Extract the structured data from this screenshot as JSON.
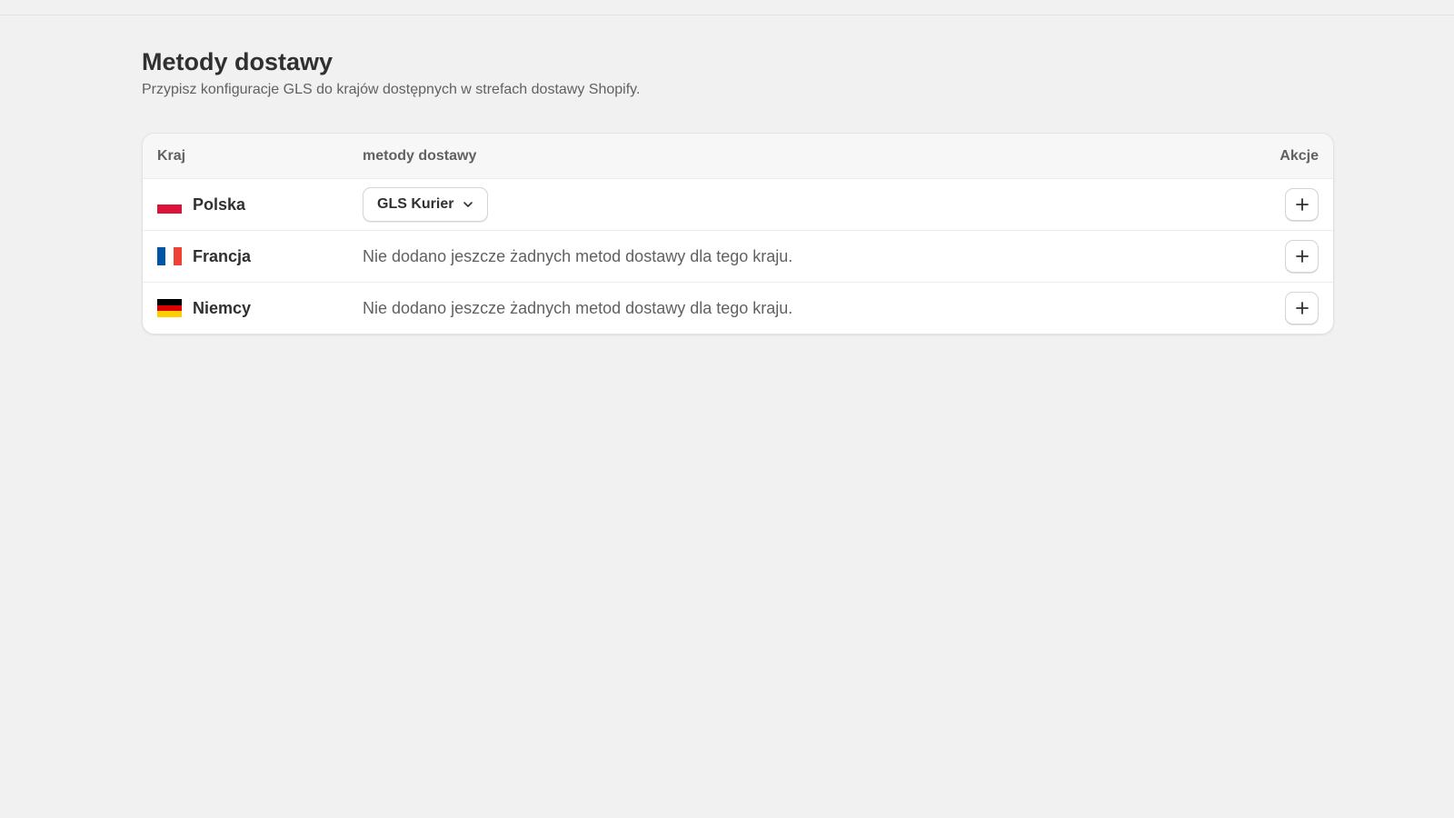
{
  "page": {
    "title": "Metody dostawy",
    "subtitle": "Przypisz konfiguracje GLS do krajów dostępnych w strefach dostawy Shopify."
  },
  "table": {
    "headers": {
      "country": "Kraj",
      "methods": "metody dostawy",
      "actions": "Akcje"
    },
    "rows": [
      {
        "country": "Polska",
        "flag": "poland-flag-icon",
        "flag_colors": [
          "#ffffff",
          "#dc143c"
        ],
        "method_select": "GLS Kurier",
        "action_icon": "plus-icon"
      },
      {
        "country": "Francja",
        "flag": "france-flag-icon",
        "flag_colors": [
          "#0055a4",
          "#ffffff",
          "#ef4135"
        ],
        "empty_text": "Nie dodano jeszcze żadnych metod dostawy dla tego kraju.",
        "action_icon": "plus-icon"
      },
      {
        "country": "Niemcy",
        "flag": "germany-flag-icon",
        "flag_colors": [
          "#000000",
          "#dd0000",
          "#ffce00"
        ],
        "empty_text": "Nie dodano jeszcze żadnych metod dostawy dla tego kraju.",
        "action_icon": "plus-icon"
      }
    ]
  },
  "colors": {
    "background": "#f1f1f1",
    "card": "#ffffff",
    "text_primary": "#303030",
    "text_secondary": "#616161"
  }
}
